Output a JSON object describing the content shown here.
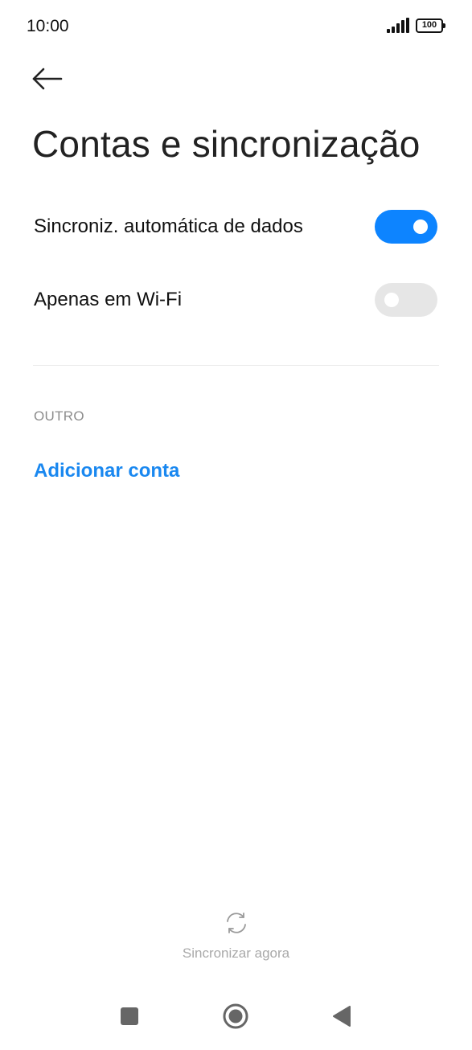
{
  "status_bar": {
    "time": "10:00",
    "battery": "100"
  },
  "header": {
    "title": "Contas e sincronização"
  },
  "settings": {
    "auto_sync": {
      "label": "Sincroniz. automática de dados",
      "enabled": true
    },
    "wifi_only": {
      "label": "Apenas em Wi-Fi",
      "enabled": false
    }
  },
  "other_section": {
    "header": "OUTRO",
    "add_account": "Adicionar conta"
  },
  "footer": {
    "sync_now": "Sincronizar agora"
  },
  "colors": {
    "accent": "#0d84ff",
    "link": "#1a88f0",
    "toggle_off": "#e6e6e6",
    "muted_text": "#8c8c8c"
  },
  "icons": {
    "back": "back-arrow-icon",
    "signal": "signal-icon",
    "battery": "battery-icon",
    "sync": "sync-icon",
    "nav_recents": "square-icon",
    "nav_home": "circle-icon",
    "nav_back": "triangle-icon"
  }
}
